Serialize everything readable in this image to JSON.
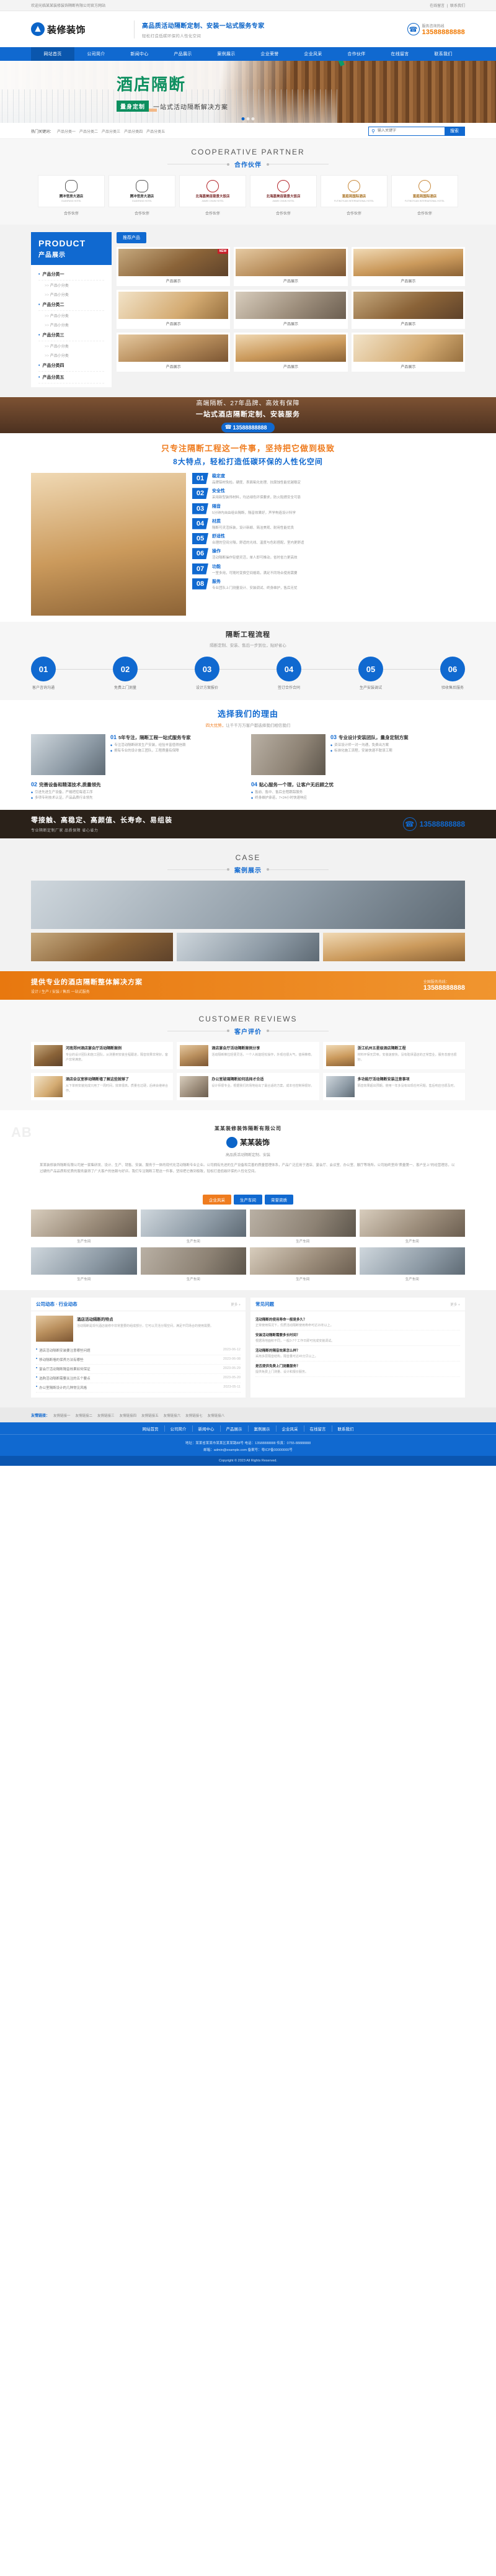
{
  "topbar": {
    "welcome": "欢迎光临某某装修装饰隔断有限公司官方网站",
    "link1": "在线留言",
    "sep": "|",
    "link2": "联系我们"
  },
  "header": {
    "logo_text": "装修装饰",
    "slogan_main": "高品质活动隔断定制、安装一站式服务专家",
    "slogan_sub": "轻松打造低碳环保的人性化空间",
    "tel_label": "服务咨询热线",
    "tel_number": "13588888888"
  },
  "nav": [
    {
      "label": "网站首页",
      "active": true
    },
    {
      "label": "公司简介",
      "active": false
    },
    {
      "label": "新闻中心",
      "active": false
    },
    {
      "label": "产品展示",
      "active": false
    },
    {
      "label": "案例展示",
      "active": false
    },
    {
      "label": "企业荣誉",
      "active": false
    },
    {
      "label": "企业风采",
      "active": false
    },
    {
      "label": "合作伙伴",
      "active": false
    },
    {
      "label": "在线留言",
      "active": false
    },
    {
      "label": "联系我们",
      "active": false
    }
  ],
  "banner": {
    "title": "酒店隔断",
    "badge": "量身定制",
    "subtitle": "一站式活动隔断解决方案"
  },
  "search": {
    "hot_label": "热门关键词：",
    "keywords": [
      "产品分类一",
      "产品分类二",
      "产品分类三",
      "产品分类四",
      "产品分类五"
    ],
    "placeholder": "输入关键字",
    "button": "搜索"
  },
  "partners": {
    "title_en": "COOPERATIVE PARTNER",
    "title_cn": "合作伙伴",
    "items": [
      {
        "name": "腾冲官房大酒店",
        "en": "GUANFANG HOTEL",
        "caption": "合作伙伴",
        "style": "g"
      },
      {
        "name": "腾冲官房大酒店",
        "en": "GUANFANG HOTEL",
        "caption": "合作伙伴",
        "style": "g"
      },
      {
        "name": "北海嘉美连锁景大饭店",
        "en": "JIAMEI CHAIN HOTEL",
        "caption": "合作伙伴",
        "style": "r"
      },
      {
        "name": "北海嘉美连锁景大饭店",
        "en": "JIAMEI CHAIN HOTEL",
        "caption": "合作伙伴",
        "style": "r"
      },
      {
        "name": "富庭苑国际酒店",
        "en": "FUTINGYUAN INTERNATIONAL HOTEL",
        "caption": "合作伙伴",
        "style": "o"
      },
      {
        "name": "富庭苑国际酒店",
        "en": "FUTINGYUAN INTERNATIONAL HOTEL",
        "caption": "合作伙伴",
        "style": "o"
      }
    ]
  },
  "product": {
    "side_en": "PRODUCT",
    "side_cn": "产品展示",
    "categories": [
      {
        "name": "产品分类一",
        "subs": [
          "产品小分类",
          "产品小分类"
        ]
      },
      {
        "name": "产品分类二",
        "subs": [
          "产品小分类",
          "产品小分类"
        ]
      },
      {
        "name": "产品分类三",
        "subs": [
          "产品小分类",
          "产品小分类"
        ]
      },
      {
        "name": "产品分类四",
        "subs": []
      },
      {
        "name": "产品分类五",
        "subs": []
      }
    ],
    "tab": "推荐产品",
    "badge": "NEW",
    "items": [
      {
        "caption": "产品展示",
        "ph": "ph-a"
      },
      {
        "caption": "产品展示",
        "ph": "ph-b"
      },
      {
        "caption": "产品展示",
        "ph": "ph-d"
      },
      {
        "caption": "产品展示",
        "ph": "ph-f"
      },
      {
        "caption": "产品展示",
        "ph": "ph-c"
      },
      {
        "caption": "产品展示",
        "ph": "ph-a"
      },
      {
        "caption": "产品展示",
        "ph": "ph-b"
      },
      {
        "caption": "产品展示",
        "ph": "ph-d"
      },
      {
        "caption": "产品展示",
        "ph": "ph-f"
      }
    ]
  },
  "cta1": {
    "line1": "高端隔断、27年品牌、高效有保障",
    "line2": "一站式酒店隔断定制、安装服务",
    "tel": "13588888888"
  },
  "advantage": {
    "title1": "只专注隔断工程这一件事，坚持把它做到极致",
    "title2": "8大特点，轻松打造低碳环保的人性化空间",
    "items": [
      {
        "no": "01",
        "title": "稳定度",
        "desc": "品牌铝材免检。硬度、表面氧化处理、抗腐蚀性能优越稳定"
      },
      {
        "no": "02",
        "title": "安全性",
        "desc": "采用新型装饰材料，均达绿色环保要求，防火阻燃安全可靠"
      },
      {
        "no": "03",
        "title": "隔音",
        "desc": "5分钟内自由组合隔断，隔音效果好，声学构造设计科学"
      },
      {
        "no": "04",
        "title": "材质",
        "desc": "隔断可灵活拆装，设计新颖、简洁美观、耐用性能优良"
      },
      {
        "no": "05",
        "title": "舒适性",
        "desc": "合理的空间分隔，舒适的光线、温度与色彩搭配，室内更舒适"
      },
      {
        "no": "06",
        "title": "操作",
        "desc": "活动隔断操作轻便灵活，单人即可推动，省时省力更高效"
      },
      {
        "no": "07",
        "title": "功能",
        "desc": "一室多用，可随时变换空间格局，满足不同场合使用需要"
      },
      {
        "no": "08",
        "title": "服务",
        "desc": "专业团队上门测量设计、安装调试、终身维护，售后无忧"
      }
    ]
  },
  "flow": {
    "title": "隔断工程流程",
    "subtitle": "隔断定制、安装、售后一步到位，贴好省心",
    "steps": [
      {
        "no": "01",
        "label": "客户咨询沟通"
      },
      {
        "no": "02",
        "label": "免费上门测量"
      },
      {
        "no": "03",
        "label": "设计方案报价"
      },
      {
        "no": "04",
        "label": "签订合作合同"
      },
      {
        "no": "05",
        "label": "生产安装调试"
      },
      {
        "no": "06",
        "label": "验收售后服务"
      }
    ]
  },
  "reasons": {
    "title": "选择我们的理由",
    "subtitle_left": "四大优势，",
    "subtitle_right": "让千千万万客户都选择我们相信我们",
    "items": [
      {
        "n": "01",
        "title": "5年专注，隔断工程一站式服务专家",
        "lines": [
          "专注活动隔断研发生产安装，经验丰富值得信赖",
          "拥有专业的设计施工团队，工程质量有保障"
        ]
      },
      {
        "n": "02",
        "title": "完善设备和精湛技术,质量领先",
        "lines": [
          "引进先进生产设备，严格把控每道工序",
          "多项专利技术认证，产品品质行业领先"
        ]
      },
      {
        "n": "03",
        "title": "专业设计安装团队，量身定制方案",
        "lines": [
          "资深设计师一对一沟通，免费出方案",
          "标准化施工流程，安装快速不耽误工期"
        ]
      },
      {
        "n": "04",
        "title": "贴心服务一个理，让客户无后顾之忧",
        "lines": [
          "售前、售中、售后全程跟踪服务",
          "终身维护承诺，7×24小时快速响应"
        ]
      }
    ]
  },
  "cta2": {
    "line1": "零接触、高稳定、高颜值、长寿命、易组装",
    "line2": "专业隔断定制厂家 品质保障 省心省力",
    "tel": "13588888888"
  },
  "cases": {
    "title_en": "CASE",
    "title_cn": "案例展示"
  },
  "band": {
    "title": "提供专业的酒店隔断整体解决方案",
    "subtitle": "设计 / 生产 / 安装 / 售后 一站式服务",
    "tel_label": "全国服务热线：",
    "tel": "13588888888"
  },
  "reviews": {
    "title_en": "CUSTOMER REVIEWS",
    "title_cn": "客户评价",
    "items": [
      {
        "title": "河南郑州酒店宴会厅活动隔断案例",
        "desc": "专业的设计团队和施工团队，从测量到安装全程跟进，隔音效果非常好，客户非常满意。"
      },
      {
        "title": "酒店宴会厅活动隔断案例分享",
        "desc": "活动隔断推拉轻便灵活，一个人就能轻松操作，外观也很大气，值得推荐。"
      },
      {
        "title": "浙江杭州五星级酒店隔断工程",
        "desc": "材料环保无异味，安装速度快，没有耽误酒店的正常营业，服务态度也很好。"
      },
      {
        "title": "酒店会议室移动隔断墙了解这些就够了",
        "desc": "从下单到安装完成只用了一周时间，效率很高，质量也过硬，后续会继续合作。"
      },
      {
        "title": "办公室玻璃隔断如何选择才合适",
        "desc": "设计师很专业，根据我们的场地给出了最合适的方案，成本也控制得很好。"
      },
      {
        "title": "多功能厅活动隔断安装注意事项",
        "desc": "隔音效果超出预期，使用一年多没有出现任何问题，售后响应也很及时。"
      }
    ]
  },
  "about": {
    "bg_en": "ABOUT\nUS",
    "title": "某某装修装饰隔断有限公司",
    "logo_text": "某某装饰",
    "sub": "高品质活动隔断定制、安装",
    "text": "某某装修装饰隔断有限公司是一家集研发、设计、生产、销售、安装、服务于一体的现代化活动隔断专业企业。公司拥有先进的生产设备和完善的质量管理体系，产品广泛应用于酒店、宴会厅、会议室、办公室、展厅等场所。公司始终坚持\"质量第一、客户至上\"的经营理念，以过硬的产品品质和优质的服务赢得了广大客户的信赖与好评。我们专注隔断工程这一件事，坚持把它做到极致，轻松打造低碳环保的人性化空间。"
  },
  "gallery": {
    "tabs": [
      {
        "label": "企业风采",
        "active": true
      },
      {
        "label": "生产车间",
        "active": false
      },
      {
        "label": "荣誉资质",
        "active": false
      }
    ],
    "items": [
      {
        "caption": "生产车间",
        "ph": "ph-c"
      },
      {
        "caption": "生产车间",
        "ph": "ph-g"
      },
      {
        "caption": "生产车间",
        "ph": "ph-e"
      },
      {
        "caption": "生产车间",
        "ph": "ph-c"
      },
      {
        "caption": "生产车间",
        "ph": "ph-g"
      },
      {
        "caption": "生产车间",
        "ph": "ph-e"
      },
      {
        "caption": "生产车间",
        "ph": "ph-c"
      },
      {
        "caption": "生产车间",
        "ph": "ph-g"
      }
    ]
  },
  "news": {
    "left": {
      "title": "公司动态 · 行业动态",
      "more": "更多 +",
      "feature_title": "酒店活动隔断的特点",
      "feature_desc": "活动隔断是现代酒店装修中非常重要的组成部分，它可以灵活分隔空间，满足不同场合的使用需要。",
      "items": [
        {
          "t": "酒店活动隔断安装要注意哪些问题",
          "d": "2023-06-12"
        },
        {
          "t": "移动隔断墙的保养方法有哪些",
          "d": "2023-06-08"
        },
        {
          "t": "宴会厅活动隔断隔音效果如何保证",
          "d": "2023-05-29"
        },
        {
          "t": "选购活动隔断需要关注的五个要点",
          "d": "2023-05-20"
        },
        {
          "t": "办公室隔断设计的几种常见风格",
          "d": "2023-05-11"
        }
      ]
    },
    "right": {
      "title": "常见问题",
      "more": "更多 +",
      "items": [
        {
          "q": "活动隔断的使用寿命一般是多久？",
          "a": "正常使用情况下，优质活动隔断使用寿命可达15年以上。"
        },
        {
          "q": "安装活动隔断需要多长时间？",
          "a": "根据场地面积不同，一般3-7个工作日即可完成安装调试。"
        },
        {
          "q": "活动隔断的隔音效果怎么样？",
          "a": "采用多层隔音结构，隔音量可达45分贝以上。"
        },
        {
          "q": "是否提供免费上门测量服务？",
          "a": "提供免费上门测量、设计和报价服务。"
        }
      ]
    }
  },
  "friendlinks": {
    "label": "友情链接：",
    "items": [
      "友情链接一",
      "友情链接二",
      "友情链接三",
      "友情链接四",
      "友情链接五",
      "友情链接六",
      "友情链接七",
      "友情链接八"
    ]
  },
  "footer": {
    "nav": [
      "网站首页",
      "公司简介",
      "新闻中心",
      "产品展示",
      "案例展示",
      "企业风采",
      "在线留言",
      "联系我们"
    ],
    "line1": "地址：某某省某某市某某区某某路88号    电话：13588888888    传真：0755-88888888",
    "line2": "邮箱：admin@example.com    备案号：粤ICP备00000000号",
    "copyright": "Copyright © 2023 All Rights Reserved."
  }
}
